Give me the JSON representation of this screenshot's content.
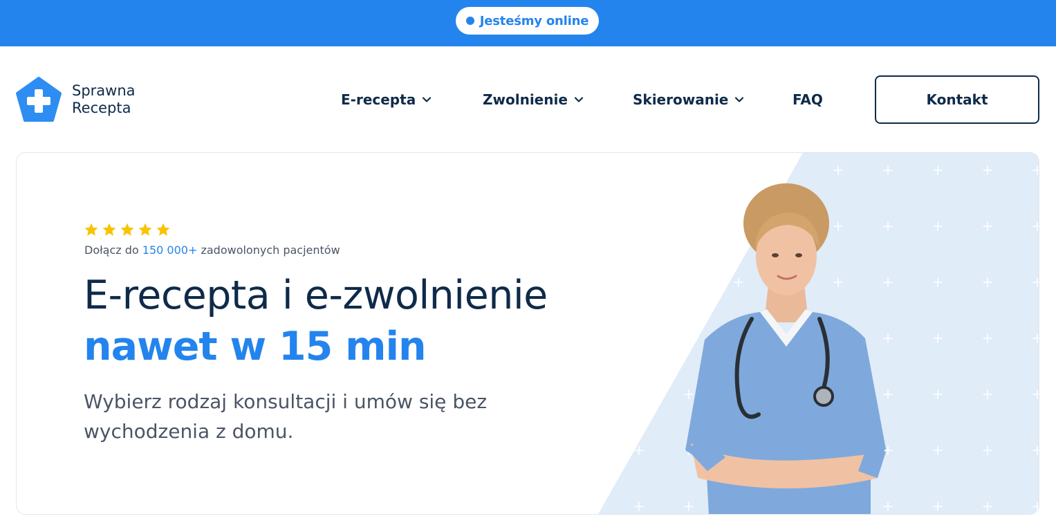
{
  "banner": {
    "status_text": "Jesteśmy online",
    "bg_color": "#2484ee"
  },
  "header": {
    "logo_line1": "Sprawna",
    "logo_line2": "Recepta",
    "nav": [
      {
        "label": "E-recepta",
        "has_dropdown": true
      },
      {
        "label": "Zwolnienie",
        "has_dropdown": true
      },
      {
        "label": "Skierowanie",
        "has_dropdown": true
      },
      {
        "label": "FAQ",
        "has_dropdown": false
      }
    ],
    "contact_label": "Kontakt"
  },
  "hero": {
    "rating_stars": 5,
    "proof_prefix": "Dołącz do",
    "proof_count": "150 000+",
    "proof_suffix": "zadowolonych pacjentów",
    "headline": "E-recepta i e-zwolnienie",
    "headline_accent": "nawet w 15 min",
    "subline": "Wybierz rodzaj konsultacji i umów się bez wychodzenia z domu."
  },
  "colors": {
    "primary": "#2484ee",
    "navy": "#0f2a4a",
    "text_muted": "#4a5565",
    "star": "#f8c400",
    "hero_panel": "#e0ecf8"
  },
  "icons": {
    "logo": "medical-cross-pentagon-icon",
    "dropdown": "chevron-down-icon",
    "rating": "star-icon"
  }
}
